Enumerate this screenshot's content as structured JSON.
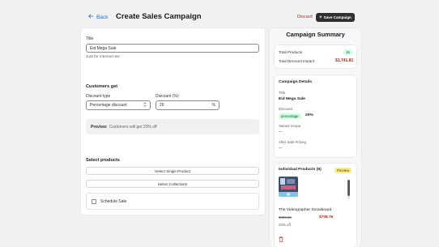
{
  "header": {
    "back_label": "Back",
    "title": "Create Sales Campaign",
    "discard_label": "Discard",
    "save_label": "Save Campaign"
  },
  "form": {
    "title_label": "Title",
    "title_value": "Eid Mega Sale",
    "title_help": "Just for internal use",
    "customers_get_heading": "Customers get",
    "discount_type_label": "Discount type",
    "discount_type_value": "Percentage discount",
    "discount_percent_label": "Discount (%)",
    "discount_percent_value": "20",
    "percent_suffix": "%",
    "preview_prefix": "Preview:",
    "preview_text": "Customers will get 20% off",
    "select_products_heading": "Select products",
    "select_single_product_label": "Select Single Product",
    "select_collections_label": "Select Collections",
    "schedule_sale_label": "Schedule Sale"
  },
  "summary": {
    "title": "Campaign Summary",
    "total_products_label": "Total Products",
    "total_products_value": "15",
    "total_discount_label": "Total Discount Impact",
    "total_discount_value": "$1,741.81"
  },
  "details": {
    "heading": "Campaign Details",
    "title_label": "Title",
    "title_value": "Eid Mega Sale",
    "discount_label": "Discount",
    "discount_badge": "percentage",
    "discount_value": "20%",
    "variant_scope_label": "Variant Scope",
    "variant_scope_value": "—",
    "after_sale_label": "After Sale Pricing",
    "after_sale_value": "—"
  },
  "products": {
    "heading": "Individual Products (6)",
    "preview_badge": "Preview",
    "items": [
      {
        "name": "The Videographer Snowboard",
        "original_price": "$885.95",
        "sale_price": "$708.76",
        "off_text": "20% off"
      }
    ]
  },
  "colors": {
    "primary_dark": "#303030",
    "link_blue": "#2c6ecb",
    "danger_red": "#c5280c",
    "success_green_bg": "#cdfee1",
    "warning_yellow_bg": "#ffeb78"
  }
}
